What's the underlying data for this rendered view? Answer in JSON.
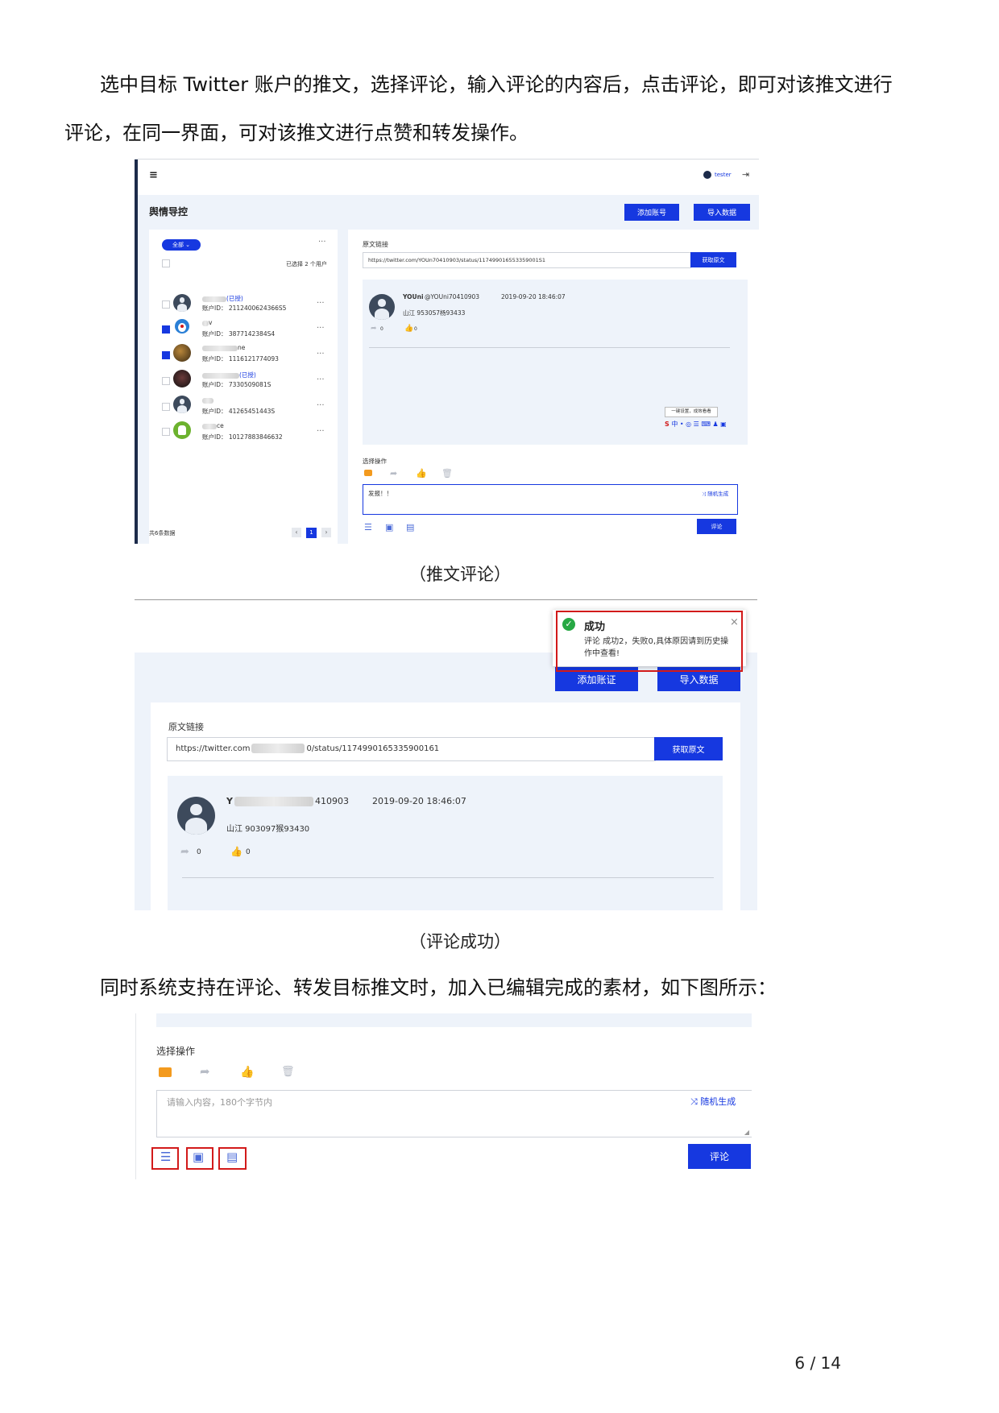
{
  "intro": {
    "line1": "选中目标 Twitter 账户的推文，选择评论，输入评论的内容后，点击评论，即可对该推文进行",
    "line2": "评论，在同一界面，可对该推文进行点赞和转发操作。"
  },
  "shot1": {
    "menu_icon": "≡",
    "user_name": "tester",
    "page_title": "舆情导控",
    "add_account_label": "添加账号",
    "import_label": "导入数据",
    "filter_label": "全部 ⌄",
    "selected_count": "已选择 2 个用户",
    "accounts": [
      {
        "name_tail": "(已授)",
        "id_line": "账户ID：  2112400624366S5",
        "checked": false,
        "avatar": "default"
      },
      {
        "name_tail": "v",
        "id_line": "账户ID：       3877142384S4",
        "checked": true,
        "avatar": "doraemon"
      },
      {
        "name_tail": "ne",
        "id_line": "账户ID：       1116121774093",
        "checked": true,
        "avatar": "photo"
      },
      {
        "name_tail": "(已授)",
        "id_line": "账户ID：       7330509081S",
        "checked": false,
        "avatar": "dark"
      },
      {
        "name_tail": "",
        "id_line": "账户ID：       41265451443S",
        "checked": false,
        "avatar": "default"
      },
      {
        "name_tail": "ce",
        "id_line": "账户ID：   10127883846632",
        "checked": false,
        "avatar": "android"
      }
    ],
    "total_label": "共6条数据",
    "pager_current": "1",
    "link_label": "原文链接",
    "link_value": "https://twitter.com/YOUn70410903/status/117499016553359001S1",
    "fetch_label": "获取原文",
    "tweet": {
      "author": "YOUni",
      "handle": "@YOUni70410903",
      "time": "2019-09-20 18:46:07",
      "text": "山江 9530S7杨93433",
      "retweets": "0",
      "likes": "0"
    },
    "ime_tip": "一键设置，成效看看",
    "ime_bar": "中 • ◎ ☰ ⌨ ♟ ▣",
    "action_label": "选择操作",
    "comment_value": "发报！！",
    "random_label": "随机生成",
    "comment_btn": "评论"
  },
  "caption1": "（推文评论）",
  "shot2": {
    "toast_title": "成功",
    "toast_msg_1": "评论 成功2，失败0,具体原因请到历史操",
    "toast_msg_2": "作中查看!",
    "toast_close": "×",
    "add_account_label": "添加账证",
    "import_label": "导入数据",
    "link_label": "原文链接",
    "link_prefix": "https://twitter.com",
    "link_suffix": "0/status/1174990165335900161",
    "fetch_label": "获取原文",
    "tweet": {
      "author_head": "Y",
      "author_tail": "410903",
      "time": "2019-09-20 18:46:07",
      "text": "山江 903097猴93430",
      "retweets": "0",
      "likes": "0"
    }
  },
  "caption2": "（评论成功）",
  "outro": "同时系统支持在评论、转发目标推文时，加入已编辑完成的素材，如下图所示：",
  "shot3": {
    "action_label": "选择操作",
    "placeholder": "请输入内容，180个字节内",
    "random_label": "随机生成",
    "comment_btn": "评论"
  },
  "page": "6 / 14",
  "colors": {
    "accent": "#1638e0",
    "highlight": "#d21a1a",
    "panel_bg": "#eef3fa",
    "success": "#27a844"
  }
}
